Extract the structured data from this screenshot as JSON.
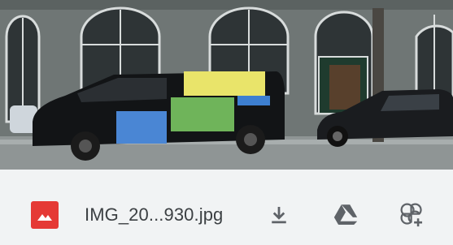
{
  "preview": {
    "type": "image",
    "subject": "photo of a black van parked on a street in front of a building"
  },
  "attachment": {
    "file_name": "IMG_20...930.jpg",
    "type_icon": "image-file-icon",
    "type_color": "#e53935"
  },
  "actions": [
    {
      "name": "download",
      "icon": "download-icon"
    },
    {
      "name": "save-to-drive",
      "icon": "google-drive-icon"
    },
    {
      "name": "add-to-photos",
      "icon": "google-photos-add-icon"
    }
  ],
  "colors": {
    "bar_background": "#f1f3f4",
    "icon_gray": "#5f6368",
    "text": "#3c4043"
  }
}
